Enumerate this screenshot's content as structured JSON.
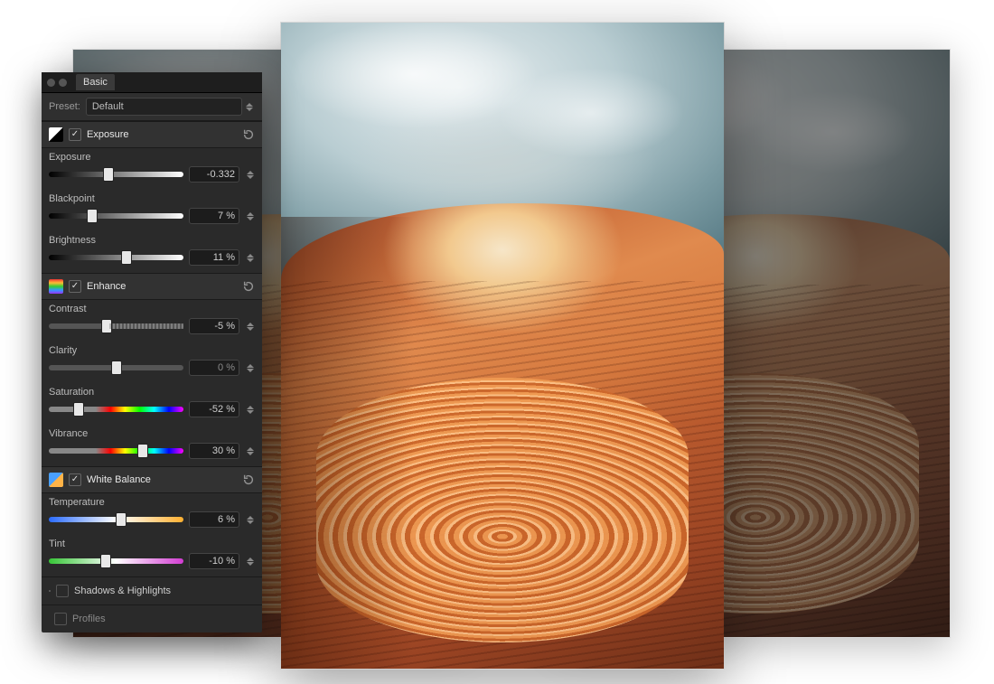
{
  "panel": {
    "tab": "Basic",
    "preset_label": "Preset:",
    "preset_value": "Default"
  },
  "sections": {
    "exposure": {
      "title": "Exposure",
      "enabled": true,
      "params": [
        {
          "name": "Exposure",
          "value": "-0.332"
        },
        {
          "name": "Blackpoint",
          "value": "7 %"
        },
        {
          "name": "Brightness",
          "value": "11 %"
        }
      ]
    },
    "enhance": {
      "title": "Enhance",
      "enabled": true,
      "params": [
        {
          "name": "Contrast",
          "value": "-5 %"
        },
        {
          "name": "Clarity",
          "value": "0 %"
        },
        {
          "name": "Saturation",
          "value": "-52 %"
        },
        {
          "name": "Vibrance",
          "value": "30 %"
        }
      ]
    },
    "white_balance": {
      "title": "White Balance",
      "enabled": true,
      "params": [
        {
          "name": "Temperature",
          "value": "6 %"
        },
        {
          "name": "Tint",
          "value": "-10 %"
        }
      ]
    },
    "shadows_highlights": {
      "title": "Shadows & Highlights",
      "enabled": false
    },
    "profiles": {
      "title": "Profiles",
      "enabled": false
    }
  }
}
